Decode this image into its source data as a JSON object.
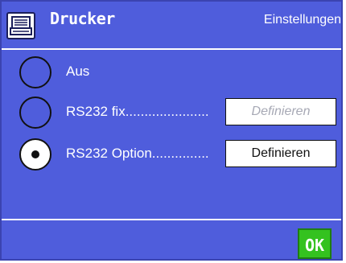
{
  "header": {
    "icon": "printer-icon",
    "title": "Drucker",
    "subtitle": "Einstellungen"
  },
  "options": [
    {
      "label": "Aus",
      "selected": false
    },
    {
      "label": "RS232 fix......................",
      "selected": false,
      "button": "Definieren",
      "button_enabled": false
    },
    {
      "label": "RS232 Option...............",
      "selected": true,
      "button": "Definieren",
      "button_enabled": true
    }
  ],
  "footer": {
    "ok_label": "OK"
  },
  "colors": {
    "background": "#4f5ddc",
    "ok_button": "#34c21f"
  }
}
